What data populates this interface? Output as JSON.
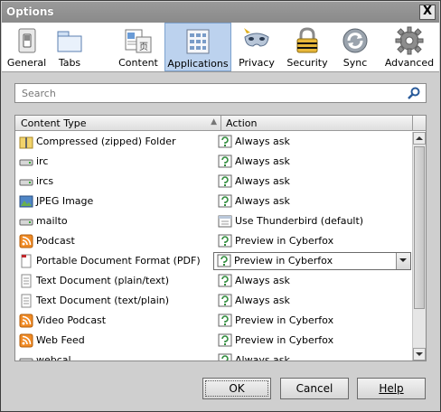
{
  "window": {
    "title": "Options",
    "close_glyph": "X"
  },
  "panes": [
    {
      "label": "General",
      "icon": "light-switch-icon"
    },
    {
      "label": "Tabs",
      "icon": "tabs-icon"
    },
    {
      "label": "Content",
      "icon": "content-page-icon"
    },
    {
      "label": "Applications",
      "icon": "applications-icon",
      "selected": true
    },
    {
      "label": "Privacy",
      "icon": "privacy-mask-icon"
    },
    {
      "label": "Security",
      "icon": "padlock-icon"
    },
    {
      "label": "Sync",
      "icon": "sync-icon"
    },
    {
      "label": "Advanced",
      "icon": "gear-icon"
    }
  ],
  "search": {
    "placeholder": "Search",
    "value": ""
  },
  "table": {
    "columns": [
      "Content Type",
      "Action"
    ],
    "rows": [
      {
        "type": "Compressed (zipped) Folder",
        "type_icon": "zip-folder-icon",
        "action": "Always ask",
        "action_icon": "ask-icon"
      },
      {
        "type": "irc",
        "type_icon": "protocol-drive-icon",
        "action": "Always ask",
        "action_icon": "ask-icon"
      },
      {
        "type": "ircs",
        "type_icon": "protocol-drive-icon",
        "action": "Always ask",
        "action_icon": "ask-icon"
      },
      {
        "type": "JPEG Image",
        "type_icon": "image-icon",
        "action": "Always ask",
        "action_icon": "ask-icon"
      },
      {
        "type": "mailto",
        "type_icon": "protocol-drive-icon",
        "action": "Use Thunderbird (default)",
        "action_icon": "app-window-icon"
      },
      {
        "type": "Podcast",
        "type_icon": "rss-feed-icon",
        "action": "Preview in Cyberfox",
        "action_icon": "ask-icon"
      },
      {
        "type": "Portable Document Format (PDF)",
        "type_icon": "pdf-icon",
        "action": "Preview in Cyberfox",
        "action_icon": "ask-icon",
        "selected": true
      },
      {
        "type": "Text Document (plain/text)",
        "type_icon": "text-document-icon",
        "action": "Always ask",
        "action_icon": "ask-icon"
      },
      {
        "type": "Text Document (text/plain)",
        "type_icon": "text-document-icon",
        "action": "Always ask",
        "action_icon": "ask-icon"
      },
      {
        "type": "Video Podcast",
        "type_icon": "rss-feed-icon",
        "action": "Preview in Cyberfox",
        "action_icon": "ask-icon"
      },
      {
        "type": "Web Feed",
        "type_icon": "rss-feed-icon",
        "action": "Preview in Cyberfox",
        "action_icon": "ask-icon"
      },
      {
        "type": "webcal",
        "type_icon": "protocol-drive-icon",
        "action": "Always ask",
        "action_icon": "ask-icon"
      }
    ]
  },
  "buttons": {
    "ok": "OK",
    "cancel": "Cancel",
    "help": "Help"
  },
  "colors": {
    "selected_pane_bg": "#bcd2ee",
    "rss_orange": "#f08a24",
    "pdf_red": "#c0282d"
  }
}
